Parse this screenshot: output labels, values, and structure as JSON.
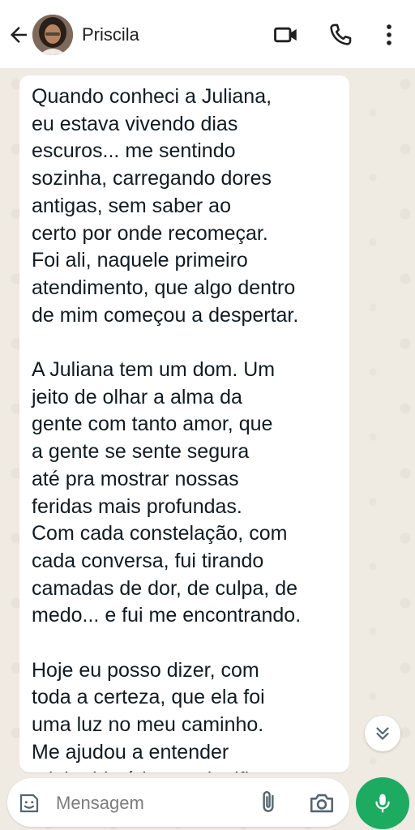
{
  "contact": {
    "name": "Priscila"
  },
  "message": {
    "text": "Quando conheci a Juliana,\neu estava vivendo dias\nescuros... me sentindo\nsozinha, carregando dores\nantigas, sem saber ao\ncerto por onde recomeçar.\nFoi ali, naquele primeiro\natendimento, que algo dentro\nde mim começou a despertar.\n\nA Juliana tem um dom. Um\njeito de olhar a alma da\ngente com tanto amor, que\na gente se sente segura\naté pra mostrar nossas\nferidas mais profundas.\nCom cada constelação, com\ncada conversa, fui tirando\ncamadas de dor, de culpa, de\nmedo... e fui me encontrando.\n\nHoje eu posso dizer, com\ntoda a certeza, que ela foi\numa luz no meu caminho.\nMe ajudou a entender\nminha história, ressignificar"
  },
  "input": {
    "placeholder": "Mensagem"
  },
  "icons": {
    "back": "back-arrow-icon",
    "video": "video-call-icon",
    "call": "phone-icon",
    "menu": "more-vertical-icon",
    "scroll": "double-chevron-down-icon",
    "emoji": "sticker-icon",
    "attach": "paperclip-icon",
    "camera": "camera-icon",
    "mic": "microphone-icon"
  },
  "colors": {
    "header_bg": "#ffffff",
    "wallpaper": "#efeae2",
    "bubble_bg": "#ffffff",
    "accent": "#1daa61"
  }
}
